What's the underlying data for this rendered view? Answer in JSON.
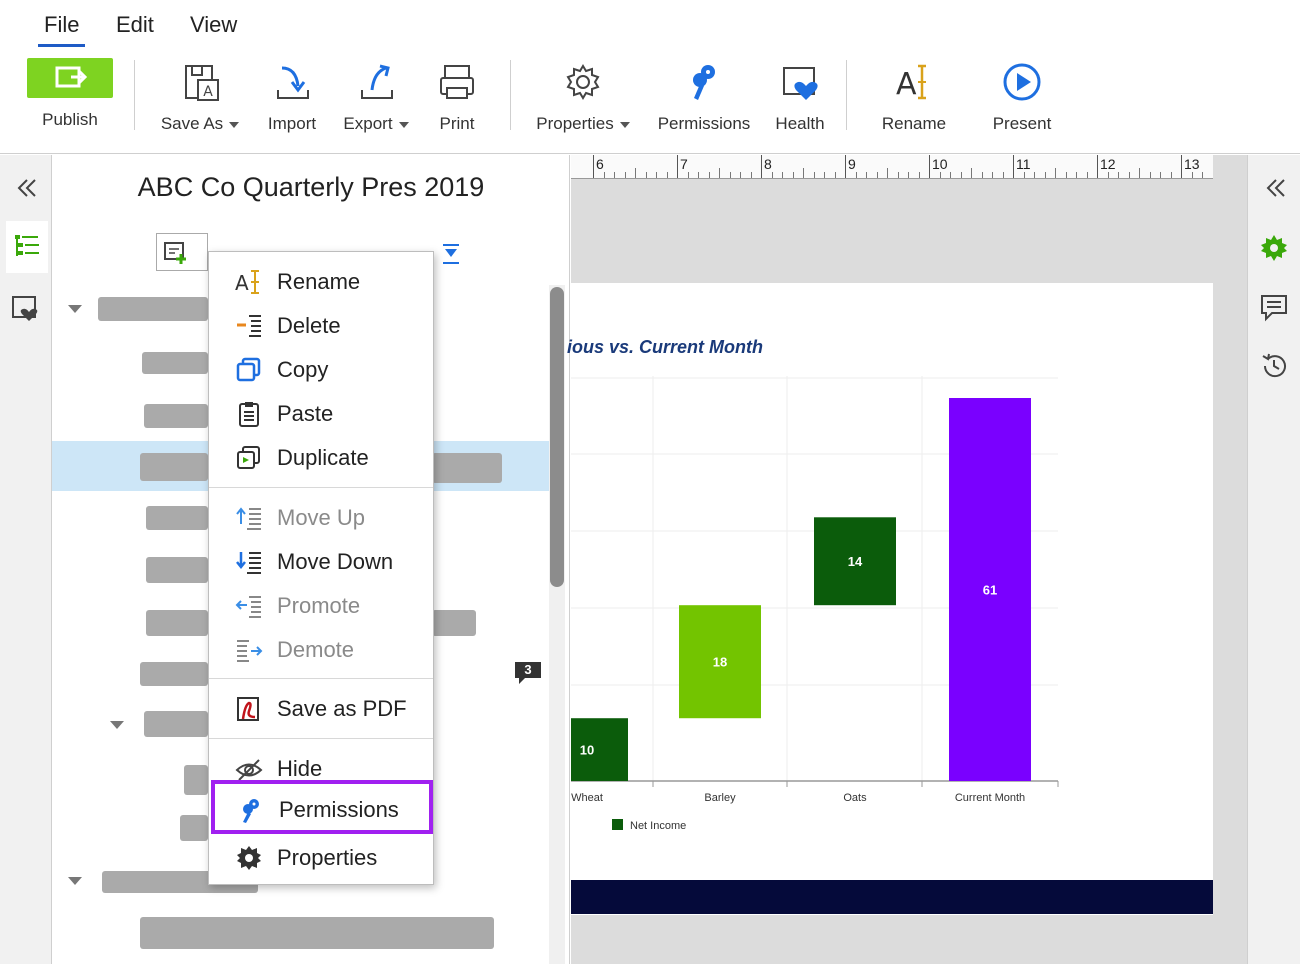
{
  "menu": {
    "tabs": [
      "File",
      "Edit",
      "View"
    ],
    "active": "File"
  },
  "ribbon": {
    "publish": "Publish",
    "save_as": "Save As",
    "import": "Import",
    "export": "Export",
    "print": "Print",
    "properties": "Properties",
    "permissions": "Permissions",
    "health": "Health",
    "rename": "Rename",
    "present": "Present"
  },
  "tree": {
    "title": "ABC Co Quarterly Pres 2019"
  },
  "context_menu": {
    "items": [
      {
        "label": "Rename",
        "enabled": true
      },
      {
        "label": "Delete",
        "enabled": true
      },
      {
        "label": "Copy",
        "enabled": true
      },
      {
        "label": "Paste",
        "enabled": true
      },
      {
        "label": "Duplicate",
        "enabled": true
      },
      {
        "label": "Move Up",
        "enabled": false
      },
      {
        "label": "Move Down",
        "enabled": true
      },
      {
        "label": "Promote",
        "enabled": false
      },
      {
        "label": "Demote",
        "enabled": false
      },
      {
        "label": "Save as PDF",
        "enabled": true
      },
      {
        "label": "Hide",
        "enabled": true
      },
      {
        "label": "Permissions",
        "enabled": true,
        "highlighted": true
      },
      {
        "label": "Properties",
        "enabled": true
      }
    ]
  },
  "ruler": {
    "numbers": [
      "6",
      "7",
      "8",
      "9",
      "10",
      "11",
      "12",
      "13"
    ]
  },
  "comment_badge": "3",
  "chart_data": {
    "type": "bar",
    "title": "ious vs. Current Month",
    "categories": [
      "Wheat",
      "Barley",
      "Oats",
      "Current Month"
    ],
    "values": [
      10,
      18,
      14,
      61
    ],
    "waterfall_base": [
      0,
      10,
      28,
      0
    ],
    "colors": [
      "#0b5c0b",
      "#73c400",
      "#0b5c0b",
      "#7a00ff"
    ],
    "legend": [
      "Net Income"
    ],
    "legend_placement": "bottom-left",
    "grid": true
  },
  "colors": {
    "accent": "#1e5bc6",
    "publish": "#7ed321",
    "highlight": "#a020f0",
    "selected_row": "#cde6f7",
    "footer": "#050a3a",
    "rail_green": "#3aa80a"
  }
}
